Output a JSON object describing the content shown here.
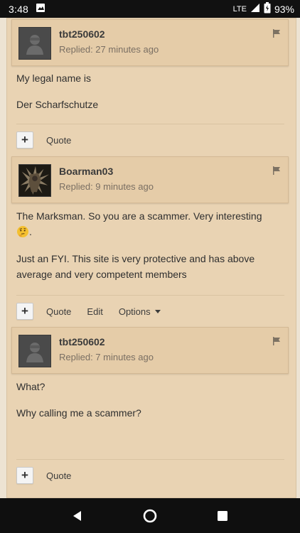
{
  "status_bar": {
    "time": "3:48",
    "network": "LTE",
    "battery_pct": "93%"
  },
  "posts": [
    {
      "username": "tbt250602",
      "replied": "Replied: 27 minutes ago",
      "paragraphs": [
        "My legal name is",
        "Der Scharfschutze"
      ],
      "actions": {
        "quote": "Quote"
      }
    },
    {
      "username": "Boarman03",
      "replied": "Replied: 9 minutes ago",
      "paragraphs": [
        "The Marksman. So you are a scammer. Very interesting",
        "Just an FYI. This site is very protective and has above average and very competent members"
      ],
      "actions": {
        "quote": "Quote",
        "edit": "Edit",
        "options": "Options"
      }
    },
    {
      "username": "tbt250602",
      "replied": "Replied: 7 minutes ago",
      "paragraphs": [
        "What?",
        "Why calling me a scammer?"
      ],
      "actions": {
        "quote": "Quote"
      }
    }
  ],
  "colors": {
    "rail": "#e9d3b3",
    "post_header": "#e5cca8",
    "status_bar": "#111111"
  }
}
